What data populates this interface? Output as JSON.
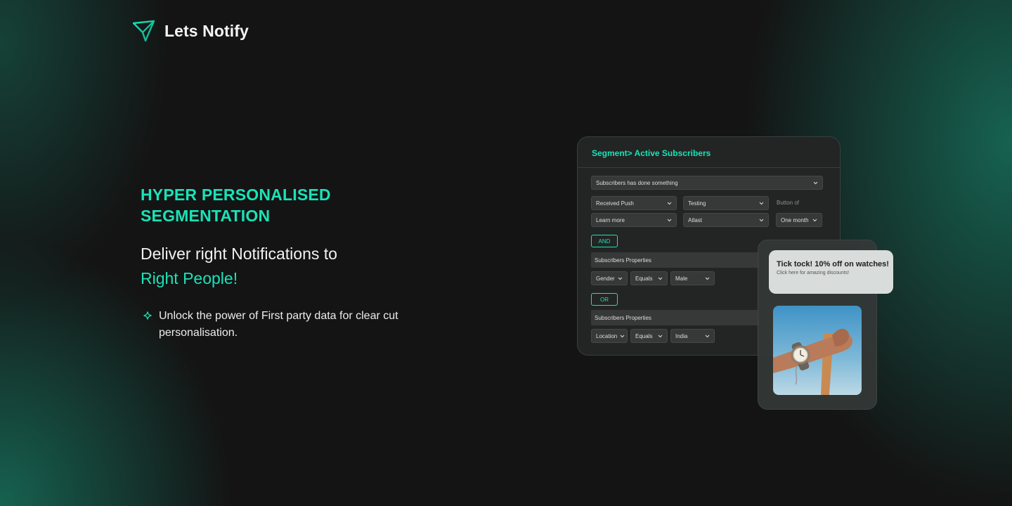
{
  "brand": {
    "name": "Lets Notify",
    "logo_icon": "paper-plane-icon",
    "accent_color": "#19e3b8"
  },
  "hero": {
    "eyebrow_line1": "HYPER PERSONALISED",
    "eyebrow_line2": "SEGMENTATION",
    "headline_line1": "Deliver right Notifications to",
    "headline_line2": "Right People!",
    "bullet_icon": "sparkle-icon",
    "bullet_text": "Unlock the power of First party data for clear cut personalisation."
  },
  "segment_card": {
    "title": "Segment> Active Subscribers",
    "event_select": "Subscribers has done something",
    "row1": {
      "event": "Received Push",
      "campaign": "Testing",
      "label": "Button of"
    },
    "row2": {
      "button": "Learn more",
      "frequency": "Atlast",
      "period": "One month"
    },
    "and_label": "AND",
    "group1": {
      "title": "Subscribers Properties",
      "property": "Gender",
      "operator": "Equals",
      "value": "Male"
    },
    "or_label": "OR",
    "group2": {
      "title": "Subscribers Properties",
      "property": "Location",
      "operator": "Equals",
      "value": "India"
    }
  },
  "notification": {
    "title": "Tick tock! 10% off on watches!",
    "subtitle": "Click here for amazing discounts!",
    "image_icon": "wristwatch-photo"
  }
}
